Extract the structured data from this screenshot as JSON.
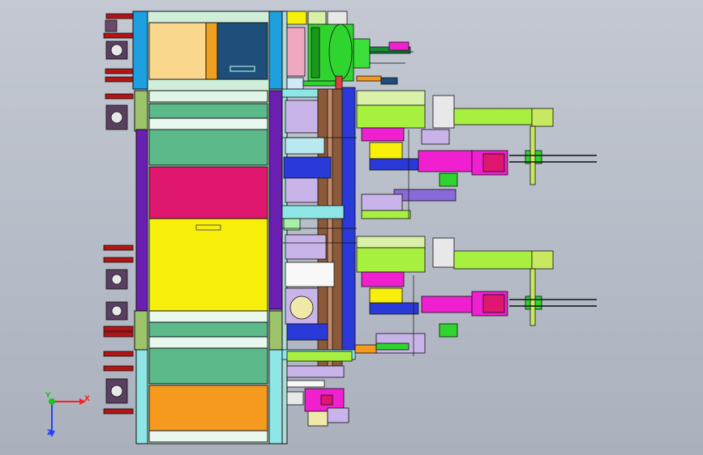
{
  "view": {
    "kind": "cad-assembly-viewport",
    "view_orientation": "front",
    "background_gradient": [
      "#c3c8d2",
      "#aab0bc"
    ]
  },
  "triad": {
    "x_label": "X",
    "y_label": "Y",
    "z_label": "Z",
    "x_color": "#ff2020",
    "y_color": "#20c020",
    "z_color": "#2040ff"
  },
  "palette": {
    "frame_cyan": "#8fe6e6",
    "frame_purple": "#6a1fb0",
    "panel_green": "#5cb98a",
    "panel_magenta": "#e0176e",
    "panel_yellow": "#f7ef0a",
    "panel_orange": "#f59a1e",
    "panel_peach": "#fbd78e",
    "panel_navy": "#1e4f7a",
    "caster_dark": "#5a4060",
    "caster_red": "#b41414",
    "drum_green": "#2fd42f",
    "accent_pink": "#f01fd0",
    "accent_blue": "#2a3ad8",
    "rail_brown": "#8a5a3a",
    "line_black": "#111111"
  }
}
